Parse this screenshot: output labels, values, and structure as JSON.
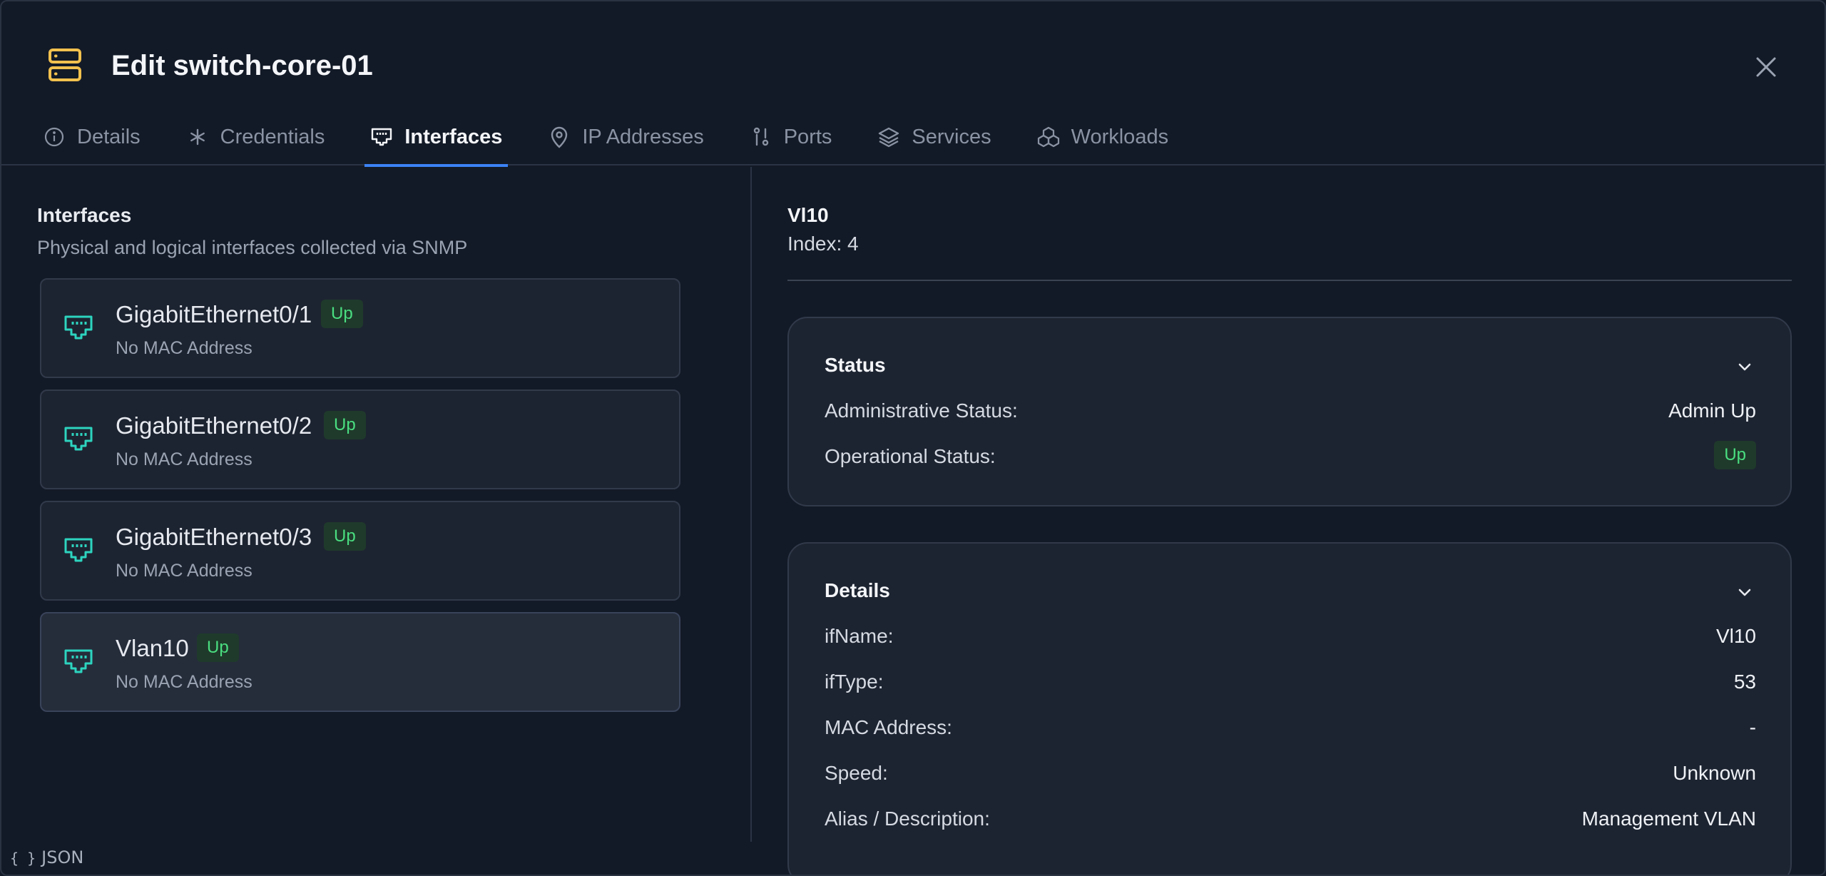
{
  "dialog": {
    "title": "Edit switch-core-01",
    "colors": {
      "accent": "#3b82f6",
      "title_icon": "#f2c14e",
      "ethernet_icon": "#2dd4bf",
      "status_up": "#4ade80"
    }
  },
  "tabs": [
    {
      "label": "Details",
      "icon": "info-icon"
    },
    {
      "label": "Credentials",
      "icon": "asterisk-icon"
    },
    {
      "label": "Interfaces",
      "icon": "ethernet-icon",
      "active": true
    },
    {
      "label": "IP Addresses",
      "icon": "map-pin-icon"
    },
    {
      "label": "Ports",
      "icon": "ports-icon"
    },
    {
      "label": "Services",
      "icon": "layers-icon"
    },
    {
      "label": "Workloads",
      "icon": "boxes-icon"
    }
  ],
  "interfaces_panel": {
    "title": "Interfaces",
    "subtitle": "Physical and logical interfaces collected via SNMP",
    "items": [
      {
        "name": "GigabitEthernet0/1",
        "status": "Up",
        "mac": "No MAC Address"
      },
      {
        "name": "GigabitEthernet0/2",
        "status": "Up",
        "mac": "No MAC Address"
      },
      {
        "name": "GigabitEthernet0/3",
        "status": "Up",
        "mac": "No MAC Address"
      },
      {
        "name": "Vlan10",
        "status": "Up",
        "mac": "No MAC Address",
        "selected": true
      }
    ]
  },
  "detail": {
    "name": "Vl10",
    "index": "Index: 4",
    "status_card": {
      "title": "Status",
      "rows": [
        {
          "label": "Administrative Status:",
          "value": "Admin Up"
        },
        {
          "label": "Operational Status:",
          "value": "Up"
        }
      ]
    },
    "details_card": {
      "title": "Details",
      "rows": [
        {
          "label": "ifName:",
          "value": "Vl10"
        },
        {
          "label": "ifType:",
          "value": "53"
        },
        {
          "label": "MAC Address:",
          "value": "-"
        },
        {
          "label": "Speed:",
          "value": "Unknown"
        },
        {
          "label": "Alias / Description:",
          "value": "Management VLAN"
        }
      ]
    }
  },
  "footer": {
    "icon": "{ }",
    "label": "JSON"
  }
}
